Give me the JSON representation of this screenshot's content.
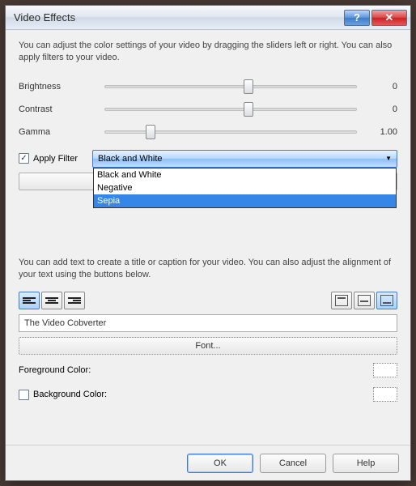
{
  "titlebar": {
    "title": "Video Effects"
  },
  "description1": "You can adjust the color settings of your video by dragging the sliders left or right. You can also apply filters to your video.",
  "sliders": {
    "brightness": {
      "label": "Brightness",
      "value": "0",
      "pos": 55
    },
    "contrast": {
      "label": "Contrast",
      "value": "0",
      "pos": 55
    },
    "gamma": {
      "label": "Gamma",
      "value": "1.00",
      "pos": 16
    }
  },
  "filter": {
    "checkbox_label": "Apply Filter",
    "checked": true,
    "selected": "Black and White",
    "options": [
      "Black and White",
      "Negative",
      "Sepia"
    ],
    "highlighted": "Sepia"
  },
  "description2": "You can add text to create a title or caption for your video. You can also adjust the alignment of your text using the buttons below.",
  "text_input": "The Video Cobverter",
  "font_button": "Font...",
  "foreground_label": "Foreground Color:",
  "background_label": "Background Color:",
  "background_checked": false,
  "buttons": {
    "ok": "OK",
    "cancel": "Cancel",
    "help": "Help"
  }
}
